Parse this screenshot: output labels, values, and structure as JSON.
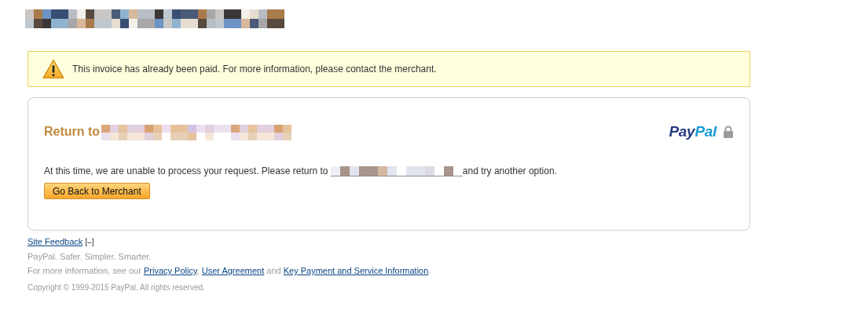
{
  "header": {
    "logo": {
      "kind": "redacted"
    }
  },
  "notice": {
    "kind": "warning",
    "text": "This invoice has already been paid. For more information, please contact the merchant."
  },
  "card": {
    "title": "Return to",
    "title_redacted": true,
    "brand": {
      "first": "Pay",
      "second": "Pal",
      "locked": true
    },
    "message": [
      {
        "kind": "text",
        "text": "At this time, we are unable to process your request. Please return to "
      },
      {
        "kind": "redacted"
      },
      {
        "kind": "text",
        "text": "and try another option."
      }
    ],
    "button": "Go Back to Merchant"
  },
  "footer": {
    "feedback": {
      "label": "Site Feedback",
      "toggle": "[–]"
    },
    "tagline": "PayPal. Safer. Simpler. Smarter.",
    "info": [
      {
        "kind": "text",
        "text": "For more information, see our "
      },
      {
        "kind": "link",
        "text": "Privacy Policy"
      },
      {
        "kind": "text",
        "text": ", "
      },
      {
        "kind": "link",
        "text": "User Agreement"
      },
      {
        "kind": "text",
        "text": " and "
      },
      {
        "kind": "link",
        "text": "Key Payment and Service Information"
      },
      {
        "kind": "text",
        "text": "."
      }
    ],
    "copyright": "Copyright © 1999-2015 PayPal. All rights reserved."
  }
}
